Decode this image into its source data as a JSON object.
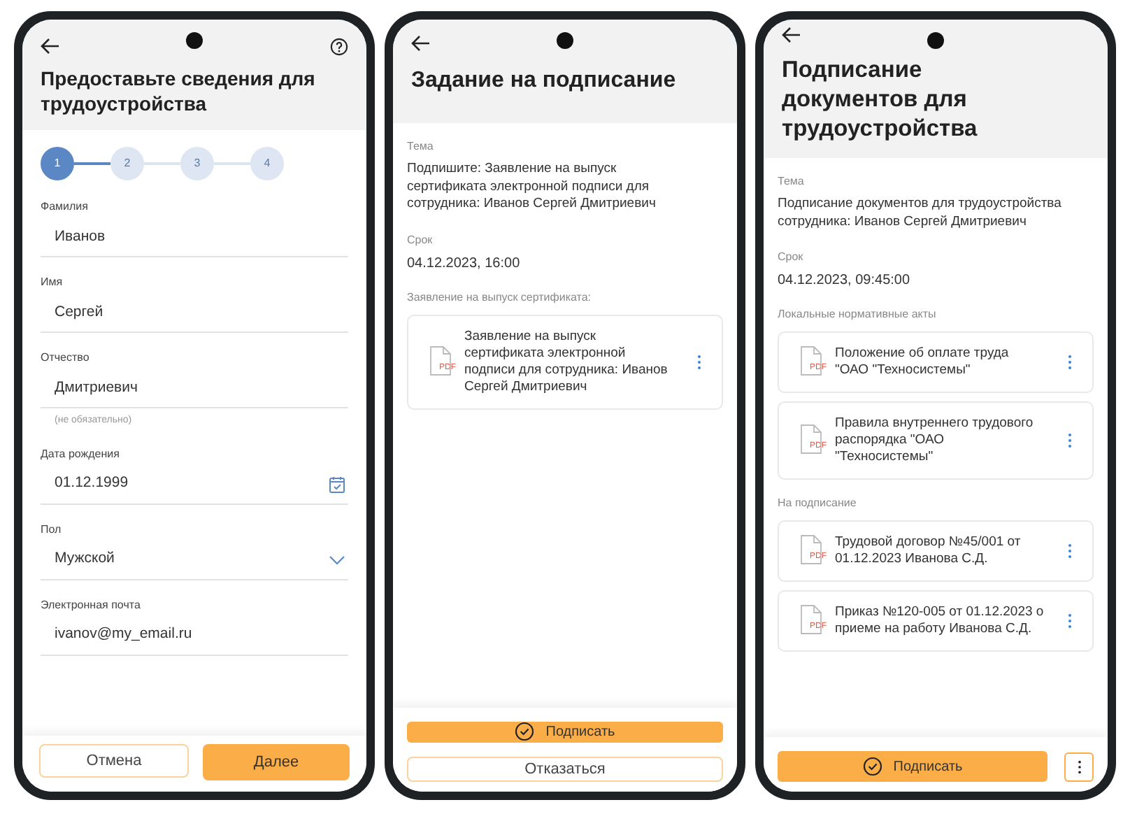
{
  "employment_form": {
    "title": "Предоставьте сведения для трудоустройства",
    "help": true,
    "steps": [
      {
        "label": "1",
        "selected": true
      },
      {
        "label": "2",
        "selected": false
      },
      {
        "label": "3",
        "selected": false
      },
      {
        "label": "4",
        "selected": false
      }
    ],
    "fields": [
      {
        "kind": "text",
        "label": "Фамилия",
        "value": "Иванов"
      },
      {
        "kind": "text",
        "label": "Имя",
        "value": "Сергей"
      },
      {
        "kind": "text",
        "label": "Отчество",
        "value": "Дмитриевич",
        "hint": "(не обязательно)"
      },
      {
        "kind": "date",
        "label": "Дата рождения",
        "value": "01.12.1999"
      },
      {
        "kind": "select",
        "label": "Пол",
        "value": "Мужской"
      },
      {
        "kind": "text",
        "label": "Электронная почта",
        "value": "ivanov@my_email.ru"
      }
    ],
    "buttons": [
      {
        "kind": "outline",
        "label": "Отмена"
      },
      {
        "kind": "primary",
        "label": "Далее"
      }
    ]
  },
  "signing_task": {
    "title": "Задание на подписание",
    "topic_label": "Тема",
    "topic": "Подпишите: Заявление на выпуск сертификата электронной подписи для сотрудника: Иванов Сергей Дмитриевич",
    "due_label": "Срок",
    "due": "04.12.2023, 16:00",
    "groups": [
      {
        "label": "Заявление на выпуск сертификата:",
        "documents": [
          {
            "file_type": "PDF",
            "name": "Заявление на выпуск сертификата электронной подписи для сотрудника: Иванов Сергей Дмитриевич"
          }
        ]
      }
    ],
    "buttons": [
      {
        "kind": "sign",
        "label": "Подписать"
      },
      {
        "kind": "outline",
        "label": "Отказаться"
      }
    ]
  },
  "document_signing": {
    "title": "Подписание документов для трудоустройства",
    "topic_label": "Тема",
    "topic": "Подписание документов для трудоустройства сотрудника: Иванов Сергей Дмитриевич",
    "due_label": "Срок",
    "due": "04.12.2023, 09:45:00",
    "groups": [
      {
        "label": "Локальные нормативные акты",
        "documents": [
          {
            "file_type": "PDF",
            "name": "Положение об оплате труда \"ОАО \"Техносистемы\""
          },
          {
            "file_type": "PDF",
            "name": "Правила внутреннего трудового распорядка \"ОАО \"Техносистемы\""
          }
        ]
      },
      {
        "label": "На подписание",
        "documents": [
          {
            "file_type": "PDF",
            "name": "Трудовой договор №45/001 от 01.12.2023 Иванова С.Д."
          },
          {
            "file_type": "PDF",
            "name": "Приказ №120-005 от 01.12.2023 о приеме на работу Иванова С.Д."
          }
        ]
      }
    ],
    "buttons": [
      {
        "kind": "sign",
        "label": "Подписать"
      },
      {
        "kind": "more"
      }
    ]
  }
}
